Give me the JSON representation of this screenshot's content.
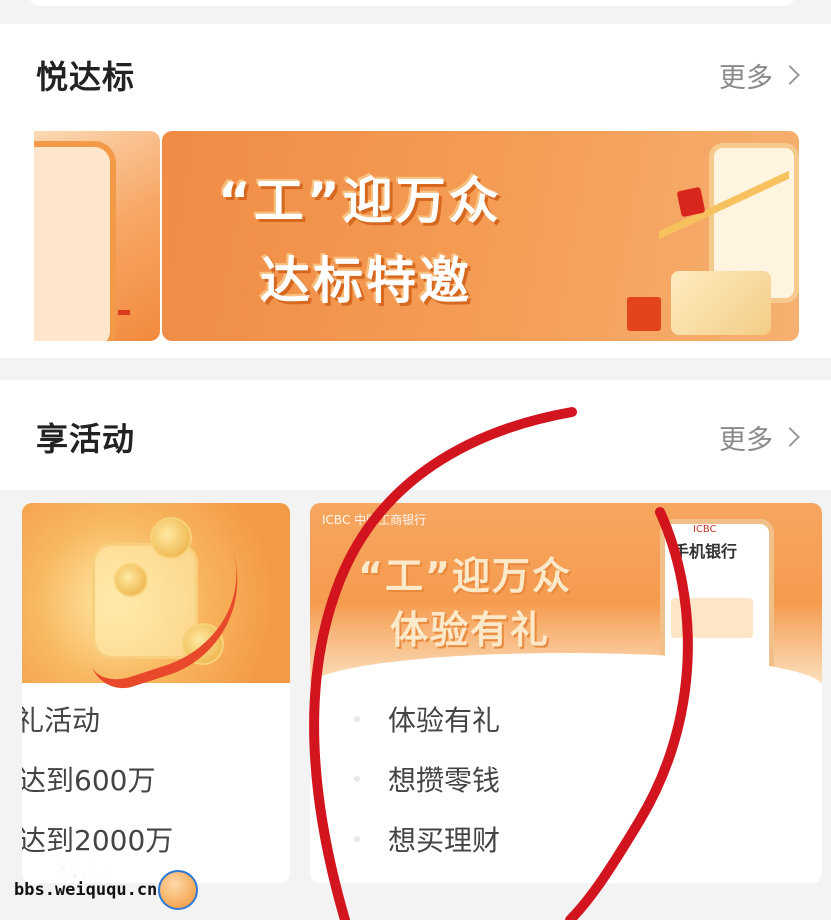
{
  "section_yueda": {
    "title": "悦达标",
    "more_label": "更多",
    "banner": {
      "line1": "“工”迎万众",
      "line2": "达标特邀"
    }
  },
  "section_activity": {
    "title": "享活动",
    "more_label": "更多",
    "card1": {
      "items": [
        "礼活动",
        "达到600万",
        "达到2000万"
      ]
    },
    "card2": {
      "bank_name": "ICBC 中国工商银行",
      "image_line1": "“工”迎万众",
      "image_line2": "体验有礼",
      "phone_title": "手机银行",
      "phone_brand": "ICBC",
      "items": [
        "体验有礼",
        "想攒零钱",
        "想买理财"
      ]
    }
  },
  "watermark": {
    "line1": "微趣趣",
    "line2": "bbs.weiququ.cn"
  },
  "colors": {
    "accent_orange": "#f49a52",
    "annotation_red": "#d2141e"
  }
}
